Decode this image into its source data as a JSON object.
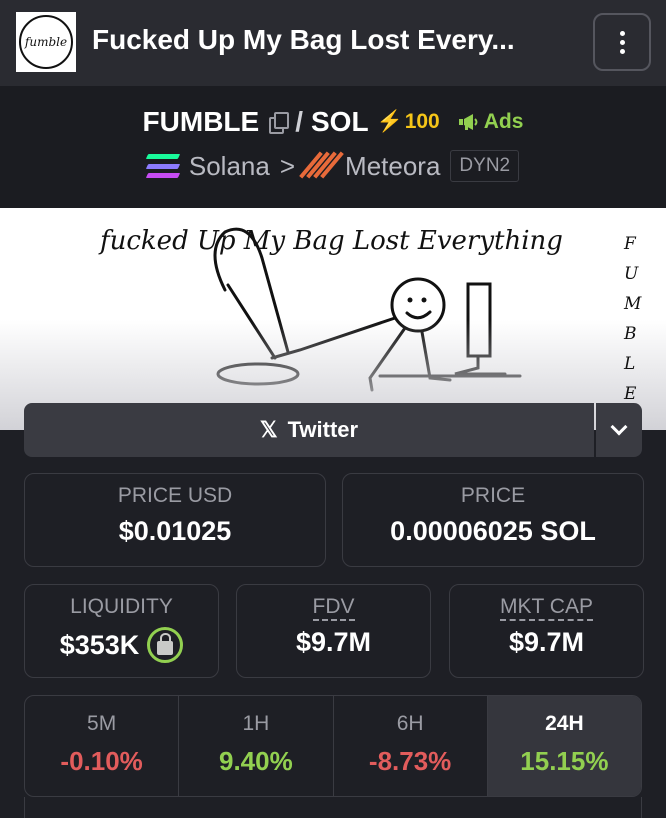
{
  "header": {
    "logo_text": "fumble",
    "title": "Fucked Up My Bag Lost Every...",
    "menu_icon": "vertical-dots-icon"
  },
  "pair": {
    "base": "FUMBLE",
    "separator": "/",
    "quote": "SOL",
    "boost_icon": "lightning-icon",
    "boost_count": "100",
    "ads_icon": "megaphone-icon",
    "ads_label": "Ads"
  },
  "chain": {
    "chain_name": "Solana",
    "chain_icon": "solana-icon",
    "arrow": ">",
    "dex_name": "Meteora",
    "dex_icon": "meteora-icon",
    "pool_badge": "DYN2"
  },
  "banner": {
    "caption": "fucked Up My Bag Lost Everything",
    "side_letters": [
      "F",
      "U",
      "M",
      "B",
      "L",
      "E"
    ]
  },
  "social": {
    "label": "Twitter",
    "icon": "x-icon",
    "dropdown_icon": "chevron-down-icon"
  },
  "stats": {
    "price_usd_label": "PRICE USD",
    "price_usd": "$0.01025",
    "price_label": "PRICE",
    "price_native": "0.00006025 SOL",
    "liquidity_label": "LIQUIDITY",
    "liquidity": "$353K",
    "fdv_label": "FDV",
    "fdv": "$9.7M",
    "mktcap_label": "MKT CAP",
    "mktcap": "$9.7M"
  },
  "changes": [
    {
      "label": "5M",
      "value": "-0.10%",
      "dir": "neg"
    },
    {
      "label": "1H",
      "value": "9.40%",
      "dir": "pos"
    },
    {
      "label": "6H",
      "value": "-8.73%",
      "dir": "neg"
    },
    {
      "label": "24H",
      "value": "15.15%",
      "dir": "pos"
    }
  ],
  "colors": {
    "positive": "#92d050",
    "negative": "#e25c5c",
    "boost": "#f5c518",
    "background": "#1e1f25"
  }
}
